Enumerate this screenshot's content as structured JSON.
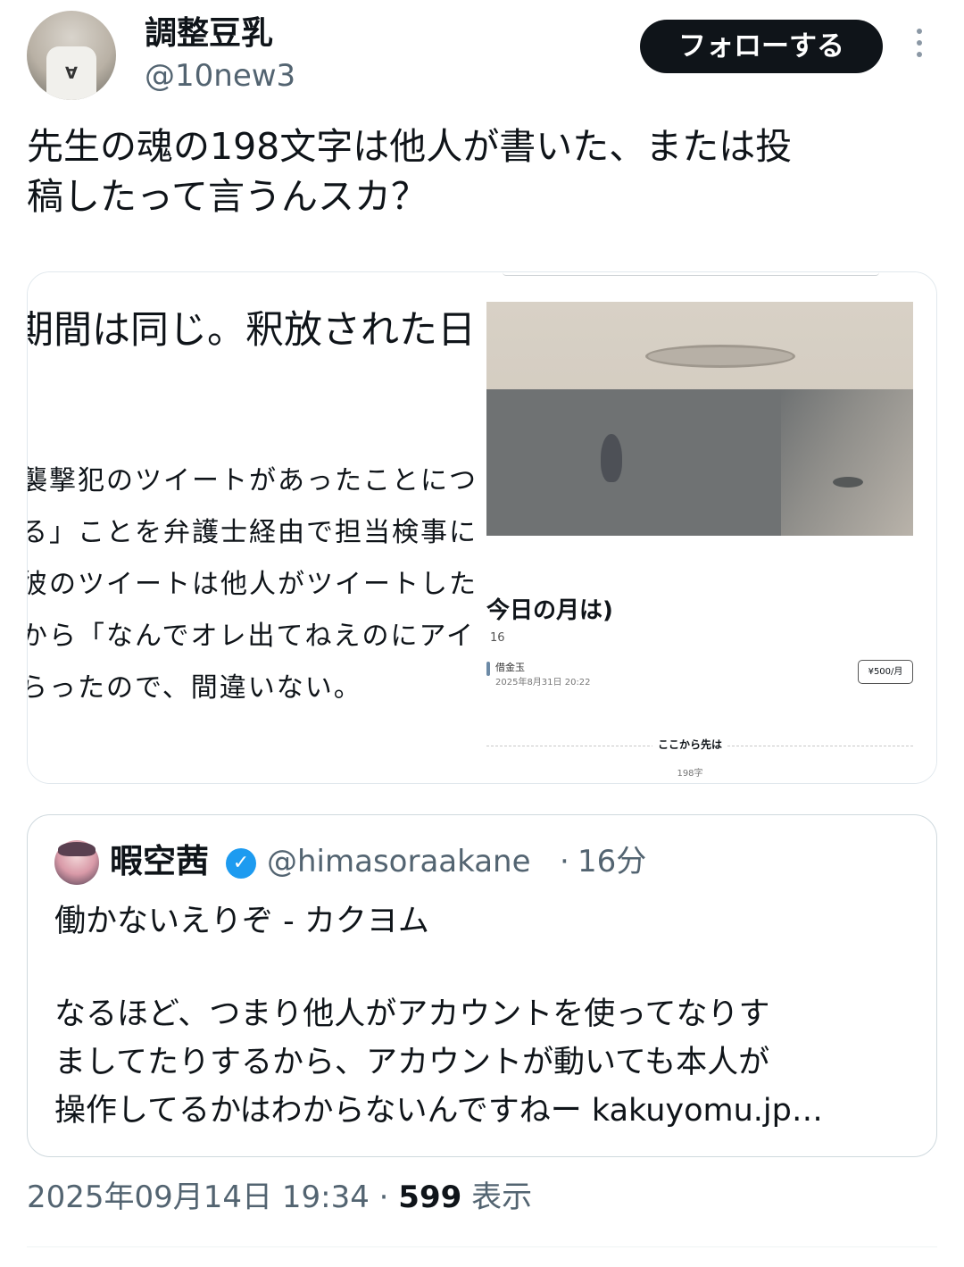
{
  "author": {
    "display_name": "調整豆乳",
    "handle": "@10new3",
    "avatar_icon": "user-avatar",
    "avatar_mark": "∀"
  },
  "follow_button": {
    "label": "フォローする"
  },
  "more_icon": "more-vertical-icon",
  "tweet": {
    "text_line1": "先生の魂の198文字は他人が書いた、または投",
    "text_line2": "稿したって言うんスカ？"
  },
  "media": {
    "left": {
      "title": "期間は同じ。釈放された日",
      "lines": [
        "襲撃犯のツイートがあったことにつ",
        "る」ことを弁護士経由で担当検事に",
        "彼のツイートは他人がツイートした",
        "から「なんでオレ出てねえのにアイツ",
        "らったので、間違いない。"
      ]
    },
    "right": {
      "heading": "今日の月は)",
      "number": "16",
      "author_name": "借金玉",
      "date": "2025年8月31日 20:22",
      "price": "¥500/月",
      "divider_label": "ここから先は",
      "char_count": "198字"
    }
  },
  "quoted_tweet": {
    "display_name": "暇空茜",
    "verified_icon": "verified-badge-icon",
    "verified_glyph": "✓",
    "handle": "@himasoraakane",
    "separator": "·",
    "time": "16分",
    "title": "働かないえりぞ - カクヨム",
    "body_line1": "なるほど、つまり他人がアカウントを使ってなりす",
    "body_line2": "ましてたりするから、アカウントが動いても本人が",
    "body_line3": "操作してるかはわからないんですねー kakuyomu.jp…"
  },
  "meta": {
    "timestamp": "2025年09月14日 19:34",
    "separator": " · ",
    "views_count": "599",
    "views_label": " 表示"
  }
}
